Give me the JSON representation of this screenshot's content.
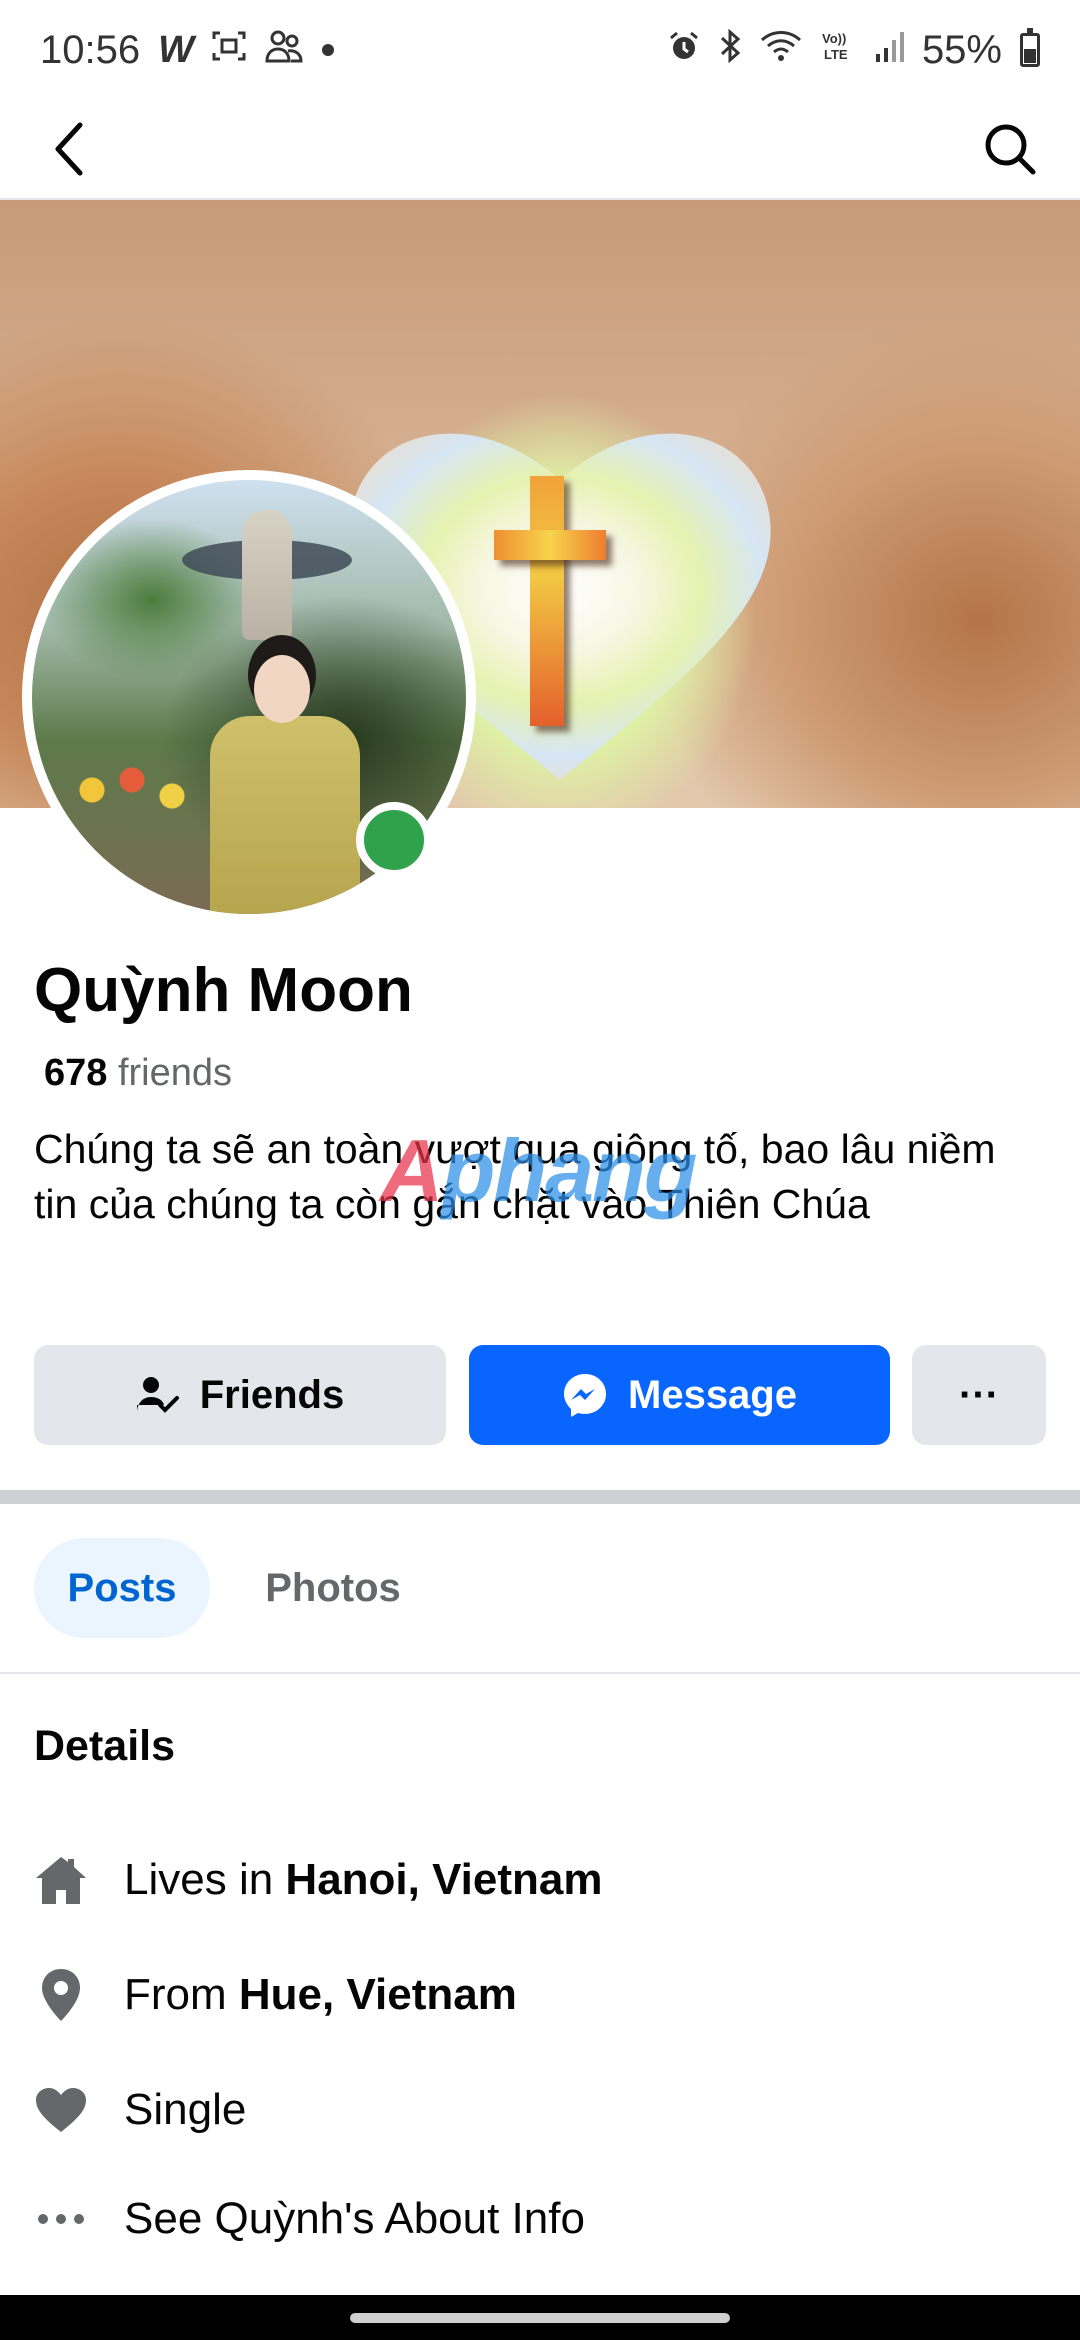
{
  "status_bar": {
    "time": "10:56",
    "app_letter": "W",
    "battery_percent": "55%",
    "battery_level": 0.55,
    "icons": [
      "screenshot-icon",
      "people-icon",
      "alarm-icon",
      "bluetooth-icon",
      "wifi-icon",
      "volte-icon",
      "signal-icon",
      "battery-icon"
    ]
  },
  "nav": {
    "back_icon": "back-arrow-icon",
    "search_icon": "search-icon"
  },
  "profile": {
    "name": "Quỳnh Moon",
    "friends_count": "678",
    "friends_label": "friends",
    "bio": "Chúng ta sẽ an toàn vượt qua giông tố, bao lâu niềm tin của chúng ta còn gắn chặt vào Thiên Chúa",
    "online": true
  },
  "actions": {
    "friends_label": "Friends",
    "message_label": "Message",
    "more_label": "···"
  },
  "tabs": [
    {
      "label": "Posts",
      "active": true
    },
    {
      "label": "Photos",
      "active": false
    }
  ],
  "details": {
    "title": "Details",
    "lives_prefix": "Lives in",
    "lives_value": "Hanoi, Vietnam",
    "from_prefix": "From",
    "from_value": "Hue, Vietnam",
    "relationship": "Single",
    "about_link": "See Quỳnh's About Info"
  },
  "watermark": {
    "part1": "A",
    "part2": "phang"
  },
  "colors": {
    "accent": "#0866ff",
    "online": "#31a24c",
    "tab_active_bg": "#ebf5ff",
    "tab_active_text": "#0064d1",
    "button_gray": "#e4e6eb",
    "secondary_text": "#65676b"
  }
}
